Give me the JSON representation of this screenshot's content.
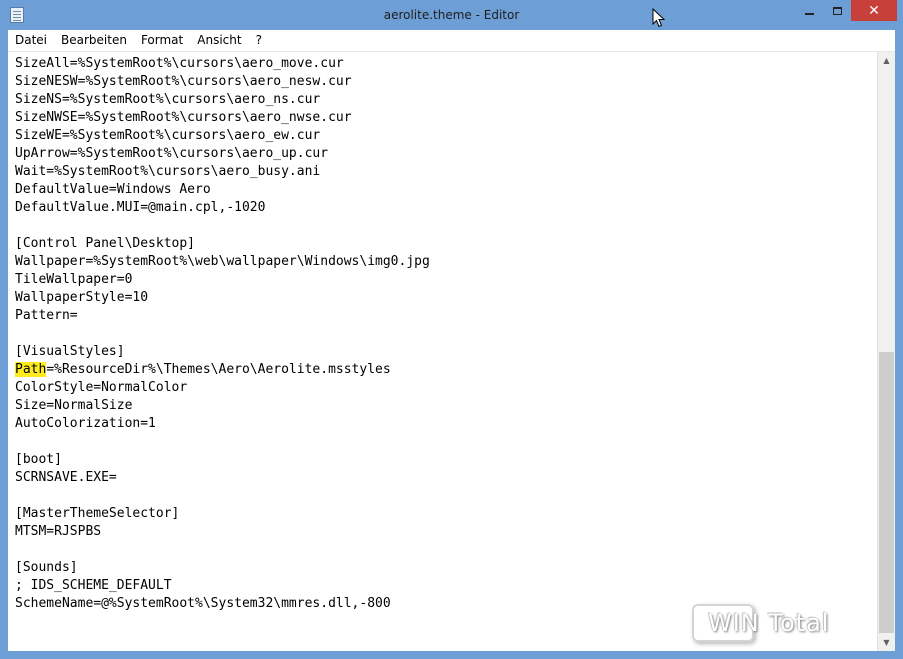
{
  "window": {
    "title": "aerolite.theme - Editor",
    "close_glyph": "✕"
  },
  "menu": [
    "Datei",
    "Bearbeiten",
    "Format",
    "Ansicht",
    "?"
  ],
  "editor": {
    "lines": [
      "SizeAll=%SystemRoot%\\cursors\\aero_move.cur",
      "SizeNESW=%SystemRoot%\\cursors\\aero_nesw.cur",
      "SizeNS=%SystemRoot%\\cursors\\aero_ns.cur",
      "SizeNWSE=%SystemRoot%\\cursors\\aero_nwse.cur",
      "SizeWE=%SystemRoot%\\cursors\\aero_ew.cur",
      "UpArrow=%SystemRoot%\\cursors\\aero_up.cur",
      "Wait=%SystemRoot%\\cursors\\aero_busy.ani",
      "DefaultValue=Windows Aero",
      "DefaultValue.MUI=@main.cpl,-1020",
      "",
      "[Control Panel\\Desktop]",
      "Wallpaper=%SystemRoot%\\web\\wallpaper\\Windows\\img0.jpg",
      "TileWallpaper=0",
      "WallpaperStyle=10",
      "Pattern=",
      "",
      "[VisualStyles]",
      "Path=%ResourceDir%\\Themes\\Aero\\Aerolite.msstyles",
      "ColorStyle=NormalColor",
      "Size=NormalSize",
      "AutoColorization=1",
      "",
      "[boot]",
      "SCRNSAVE.EXE=",
      "",
      "[MasterThemeSelector]",
      "MTSM=RJSPBS",
      "",
      "[Sounds]",
      "; IDS_SCHEME_DEFAULT",
      "SchemeName=@%SystemRoot%\\System32\\mmres.dll,-800"
    ],
    "highlight": {
      "line": 17,
      "text": "Path",
      "color": "#ffeb1e"
    }
  },
  "scrollbar": {
    "thumb_start_fraction": 0.5,
    "thumb_end_fraction": 1.0
  },
  "watermark": {
    "text": "WIN Total"
  },
  "colors": {
    "titlebar": "#6d9fd6",
    "close_button": "#c7403a"
  },
  "icons": [
    "notepad-icon",
    "minimize-icon",
    "maximize-icon",
    "close-icon",
    "scroll-up-icon",
    "scroll-down-icon",
    "mouse-cursor-icon"
  ]
}
